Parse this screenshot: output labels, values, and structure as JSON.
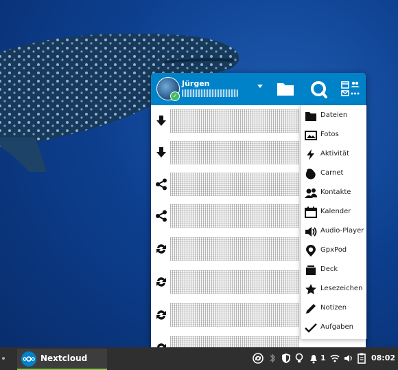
{
  "nextcloud": {
    "account": {
      "username": "Jürgen"
    },
    "activity_icons": [
      "download-icon",
      "download-icon",
      "share-icon",
      "share-icon",
      "sync-icon",
      "sync-icon",
      "sync-icon",
      "sync-icon"
    ],
    "apps_menu": [
      {
        "label": "Dateien",
        "icon": "folder-icon"
      },
      {
        "label": "Fotos",
        "icon": "image-icon"
      },
      {
        "label": "Aktivität",
        "icon": "lightning-icon"
      },
      {
        "label": "Carnet",
        "icon": "carnet-icon"
      },
      {
        "label": "Kontakte",
        "icon": "contacts-icon"
      },
      {
        "label": "Kalender",
        "icon": "calendar-icon"
      },
      {
        "label": "Audio-Player",
        "icon": "speaker-icon"
      },
      {
        "label": "GpxPod",
        "icon": "map-pin-icon"
      },
      {
        "label": "Deck",
        "icon": "deck-icon"
      },
      {
        "label": "Lesezeichen",
        "icon": "star-icon"
      },
      {
        "label": "Notizen",
        "icon": "pencil-icon"
      },
      {
        "label": "Aufgaben",
        "icon": "checkmark-icon"
      }
    ]
  },
  "taskbar": {
    "app_label": "Nextcloud",
    "notification_count": "1",
    "clock": "08:02"
  }
}
